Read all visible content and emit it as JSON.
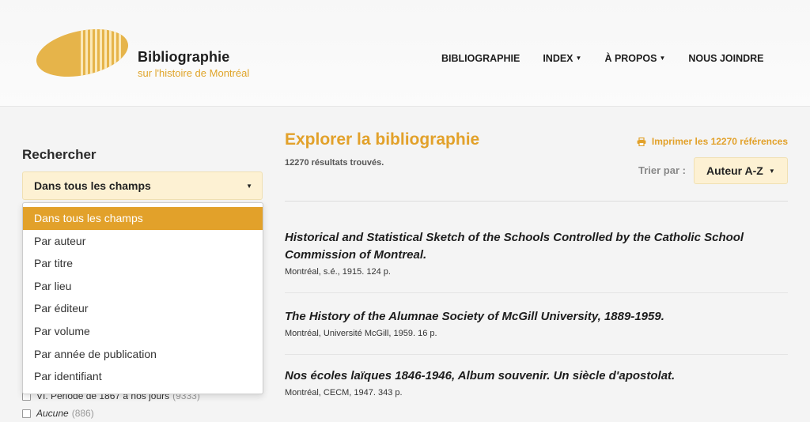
{
  "header": {
    "brand_title": "Bibliographie",
    "brand_subtitle": "sur l'histoire de Montréal",
    "nav": [
      {
        "label": "BIBLIOGRAPHIE",
        "has_caret": false
      },
      {
        "label": "INDEX",
        "has_caret": true
      },
      {
        "label": "À PROPOS",
        "has_caret": true
      },
      {
        "label": "NOUS JOINDRE",
        "has_caret": false
      }
    ]
  },
  "search": {
    "heading": "Rechercher",
    "selected": "Dans tous les champs",
    "options": [
      "Dans tous les champs",
      "Par auteur",
      "Par titre",
      "Par lieu",
      "Par éditeur",
      "Par volume",
      "Par année de publication",
      "Par identifiant"
    ],
    "active_index": 0
  },
  "filters": [
    {
      "label": "VI. Période de 1867 à nos jours",
      "count": "(9333)",
      "italic": false
    },
    {
      "label": "Aucune",
      "count": "(886)",
      "italic": true
    }
  ],
  "main": {
    "title": "Explorer la bibliographie",
    "results_count": "12270 résultats trouvés.",
    "print_label": "Imprimer les 12270 références",
    "sort_label": "Trier par :",
    "sort_value": "Auteur A-Z"
  },
  "results": [
    {
      "title": "Historical and Statistical Sketch of the Schools Controlled by the Catholic School Commission of Montreal.",
      "meta": "Montréal, s.é., 1915. 124 p."
    },
    {
      "title": "The History of the Alumnae Society of McGill University, 1889-1959.",
      "meta": "Montréal, Université McGill, 1959. 16 p."
    },
    {
      "title": "Nos écoles laïques 1846-1946, Album souvenir. Un siècle d'apostolat.",
      "meta": "Montréal, CECM, 1947. 343 p."
    }
  ],
  "colors": {
    "accent": "#e2a12a",
    "accent_light": "#fdf1d3"
  }
}
